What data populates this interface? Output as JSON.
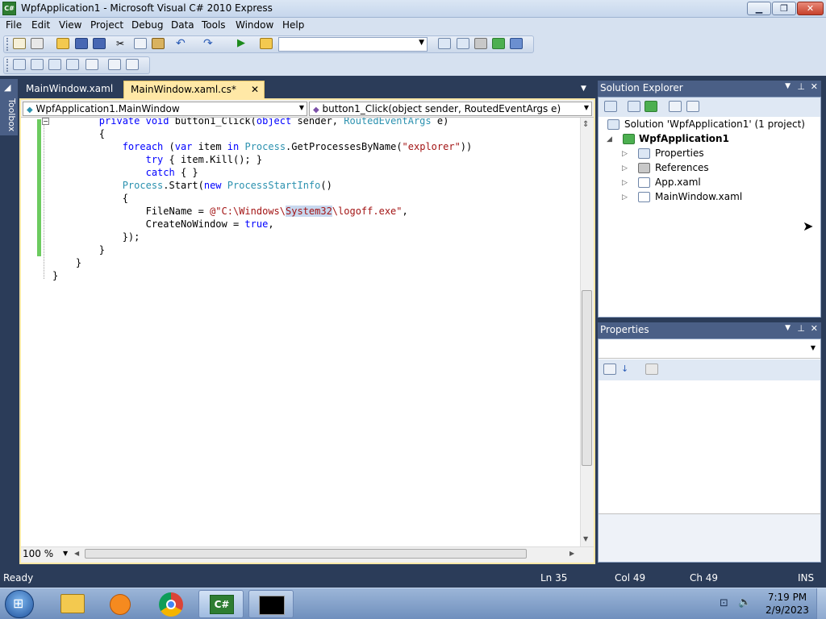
{
  "window": {
    "title": "WpfApplication1 - Microsoft Visual C# 2010 Express",
    "app_icon_label": "C#",
    "minimize_icon": "minimize-icon",
    "maximize_icon": "maximize-icon",
    "close_icon": "close-icon"
  },
  "menu": {
    "items": [
      "File",
      "Edit",
      "View",
      "Project",
      "Debug",
      "Data",
      "Tools",
      "Window",
      "Help"
    ]
  },
  "toolbar": {
    "config_combo_value": "",
    "icons": [
      "new-project-icon",
      "add-item-icon",
      "open-icon",
      "save-icon",
      "save-all-icon",
      "cut-icon",
      "copy-icon",
      "paste-icon",
      "undo-icon",
      "redo-icon",
      "start-debugging-icon",
      "find-in-files-icon",
      "solution-explorer-icon",
      "properties-window-icon",
      "object-browser-icon",
      "toolbox-icon",
      "start-page-icon"
    ]
  },
  "toolbox": {
    "label": "Toolbox"
  },
  "tabs": [
    {
      "label": "MainWindow.xaml",
      "active": false
    },
    {
      "label": "MainWindow.xaml.cs*",
      "active": true
    }
  ],
  "tab_close_glyph": "✕",
  "navbar": {
    "type_combo": "WpfApplication1.MainWindow",
    "member_combo": "button1_Click(object sender, RoutedEventArgs e)"
  },
  "code_lines": [
    "        private void button1_Click(object sender, RoutedEventArgs e)",
    "        {",
    "            foreach (var item in Process.GetProcessesByName(\"explorer\"))",
    "                try { item.Kill(); }",
    "                catch { }",
    "            Process.Start(new ProcessStartInfo()",
    "            {",
    "                FileName = @\"C:\\Windows\\System32\\logoff.exe\",",
    "                CreateNoWindow = true,",
    "            });",
    "        }",
    "    }",
    "}"
  ],
  "editor": {
    "zoom": "100 %",
    "highlighted_word": "System32"
  },
  "solution_explorer": {
    "title": "Solution Explorer",
    "solution": "Solution 'WpfApplication1' (1 project)",
    "project": "WpfApplication1",
    "items": [
      "Properties",
      "References",
      "App.xaml",
      "MainWindow.xaml"
    ]
  },
  "properties_panel": {
    "title": "Properties"
  },
  "status": {
    "ready": "Ready",
    "line": "Ln 35",
    "col": "Col 49",
    "ch": "Ch 49",
    "mode": "INS"
  },
  "taskbar": {
    "time": "7:19 PM",
    "date": "2/9/2023",
    "apps": [
      "windows-explorer-icon",
      "media-player-icon",
      "chrome-icon",
      "visual-csharp-icon",
      "command-prompt-icon"
    ]
  },
  "colors": {
    "accent": "#2b3c59",
    "active_tab": "#ffe8a6",
    "keyword": "#0000ff",
    "type": "#2b91af",
    "string": "#a31515",
    "change_bar": "#6ccb5f"
  }
}
